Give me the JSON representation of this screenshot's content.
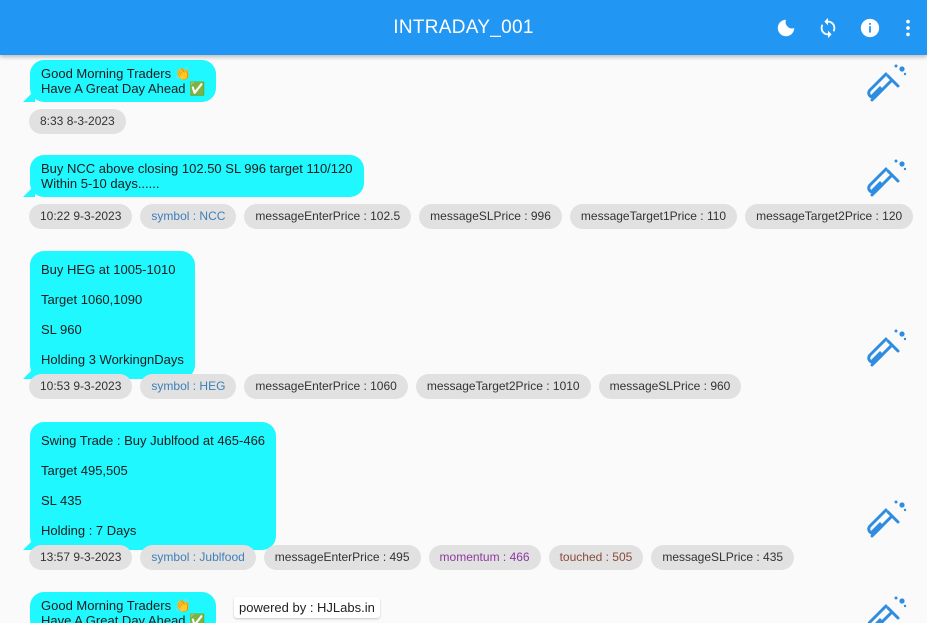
{
  "appbar": {
    "title": "INTRADAY_001",
    "actions": [
      "moon-icon",
      "refresh-icon",
      "info-icon",
      "more-vert-icon"
    ]
  },
  "messages": [
    {
      "lines": [
        "Good Morning Traders 👏",
        "Have A Great Day Ahead ✅"
      ],
      "tags": [
        {
          "text": "8:33 8-3-2023",
          "kind": "time"
        }
      ]
    },
    {
      "lines": [
        "Buy NCC above closing 102.50 SL 996 target 110/120",
        "Within 5-10 days......"
      ],
      "tags": [
        {
          "text": "10:22 9-3-2023",
          "kind": "time"
        },
        {
          "text": "symbol : NCC",
          "kind": "symbol"
        },
        {
          "text": "messageEnterPrice : 102.5",
          "kind": "plain"
        },
        {
          "text": "messageSLPrice : 996",
          "kind": "plain"
        },
        {
          "text": "messageTarget1Price : 110",
          "kind": "plain"
        },
        {
          "text": "messageTarget2Price : 120",
          "kind": "plain"
        }
      ]
    },
    {
      "lines": [
        "Buy HEG at 1005-1010",
        "Target 1060,1090",
        "SL 960",
        "Holding 3 WorkingnDays"
      ],
      "tags": [
        {
          "text": "10:53 9-3-2023",
          "kind": "time"
        },
        {
          "text": "symbol : HEG",
          "kind": "symbol"
        },
        {
          "text": "messageEnterPrice : 1060",
          "kind": "plain"
        },
        {
          "text": "messageTarget2Price : 1010",
          "kind": "plain"
        },
        {
          "text": "messageSLPrice : 960",
          "kind": "plain"
        }
      ]
    },
    {
      "lines": [
        "Swing Trade : Buy Jublfood at 465-466",
        "Target 495,505",
        "SL 435",
        "Holding : 7 Days"
      ],
      "tags": [
        {
          "text": "13:57 9-3-2023",
          "kind": "time"
        },
        {
          "text": "symbol : Jublfood",
          "kind": "symbol"
        },
        {
          "text": "messageEnterPrice : 495",
          "kind": "plain"
        },
        {
          "text": "momentum : 466",
          "kind": "momentum"
        },
        {
          "text": "touched : 505",
          "kind": "touched"
        },
        {
          "text": "messageSLPrice : 435",
          "kind": "plain"
        }
      ]
    },
    {
      "lines": [
        "Good Morning Traders 👏",
        "Have A Great Day Ahead ✅"
      ],
      "tags": []
    }
  ],
  "footer": {
    "powered_by": "powered by : HJLabs.in"
  },
  "colors": {
    "appbar": "#2196f3",
    "bubble": "#1ff8ff",
    "chip": "#e1e1e1",
    "flask": "#2e8de0"
  }
}
